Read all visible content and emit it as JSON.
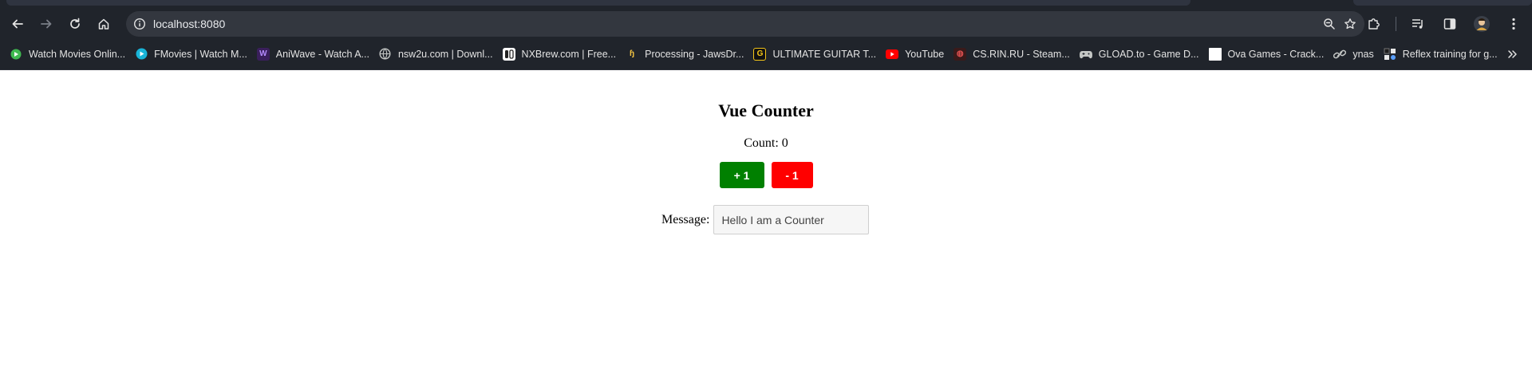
{
  "browser": {
    "url": "localhost:8080",
    "bookmarks": [
      {
        "label": "Watch Movies Onlin...",
        "icon": "green-circle-icon",
        "color": "#3fb950"
      },
      {
        "label": "FMovies | Watch M...",
        "icon": "teal-play-icon",
        "color": "#18b4d8"
      },
      {
        "label": "AniWave - Watch A...",
        "icon": "aniwave-w-icon",
        "color": "#3a1f5c"
      },
      {
        "label": "nsw2u.com | Downl...",
        "icon": "globe-icon",
        "color": "#c4c7c5"
      },
      {
        "label": "NXBrew.com | Free...",
        "icon": "switch-icon",
        "color": "#ffffff"
      },
      {
        "label": "Processing - JawsDr...",
        "icon": "processing-icon",
        "color": "#f5c542"
      },
      {
        "label": "ULTIMATE GUITAR T...",
        "icon": "ug-icon",
        "color": "#f5c518"
      },
      {
        "label": "YouTube",
        "icon": "youtube-icon",
        "color": "#ff0000"
      },
      {
        "label": "CS.RIN.RU - Steam...",
        "icon": "csrin-icon",
        "color": "#a02020"
      },
      {
        "label": "GLOAD.to - Game D...",
        "icon": "gamepad-icon",
        "color": "#c4c7c5"
      },
      {
        "label": "Ova Games - Crack...",
        "icon": "white-square-icon",
        "color": "#ffffff"
      },
      {
        "label": "ynas",
        "icon": "link-icon",
        "color": "#c4c7c5"
      },
      {
        "label": "Reflex training for g...",
        "icon": "reflex-icon",
        "color": "#5aa0ff"
      }
    ]
  },
  "app": {
    "title": "Vue Counter",
    "count_label": "Count: 0",
    "increment_label": "+ 1",
    "decrement_label": "- 1",
    "message_label": "Message:",
    "message_value": "Hello I am a Counter",
    "increment_color": "#008000",
    "decrement_color": "#ff0000"
  }
}
